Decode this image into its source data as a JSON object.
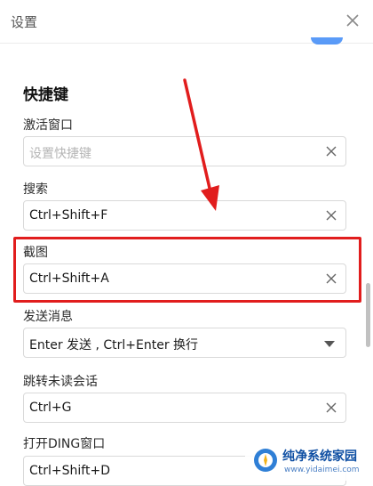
{
  "window": {
    "title": "设置"
  },
  "section": {
    "title": "快捷键"
  },
  "shortcuts": [
    {
      "label": "激活窗口",
      "value": "",
      "placeholder": "设置快捷键"
    },
    {
      "label": "搜索",
      "value": "Ctrl+Shift+F",
      "placeholder": ""
    },
    {
      "label": "截图",
      "value": "Ctrl+Shift+A",
      "placeholder": ""
    },
    {
      "label": "发送消息",
      "value": "Enter 发送 , Ctrl+Enter 换行",
      "placeholder": ""
    },
    {
      "label": "跳转未读会话",
      "value": "Ctrl+G",
      "placeholder": ""
    },
    {
      "label": "打开DING窗口",
      "value": "Ctrl+Shift+D",
      "placeholder": ""
    }
  ],
  "icons": {
    "close": "close-icon",
    "clear": "clear-icon",
    "dropdown": "chevron-down-icon",
    "logo": "logo-icon"
  },
  "colors": {
    "highlight": "#e11d1d",
    "accent": "#3d8af7",
    "watermark": "#0f4fa3"
  },
  "watermark": {
    "name": "纯净系统家园",
    "url": "www.yidaimei.com"
  }
}
